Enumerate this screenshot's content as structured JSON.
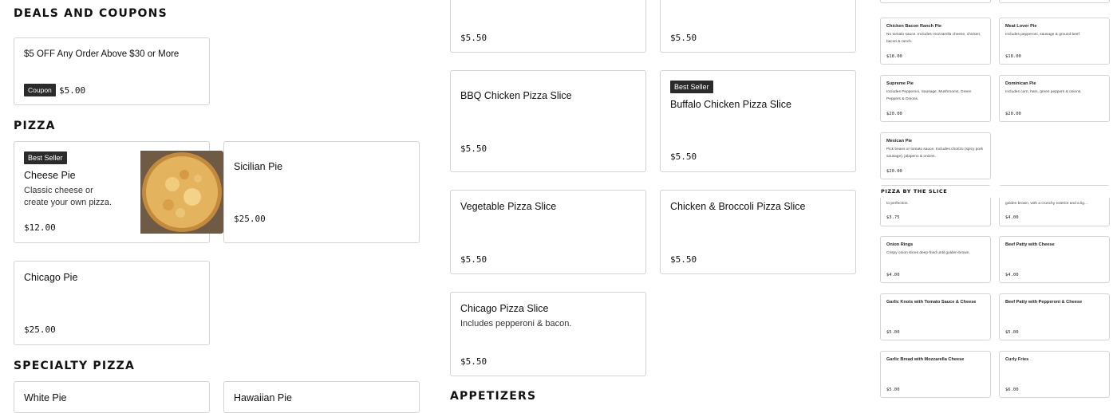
{
  "sections": {
    "deals": "DEALS AND COUPONS",
    "pizza": "PIZZA",
    "specialty": "SPECIALTY PIZZA",
    "appetizers": "APPETIZERS",
    "by_slice": "PIZZA BY THE SLICE"
  },
  "deal": {
    "title": "$5 OFF Any Order Above $30 or More",
    "badge": "Coupon",
    "amount": "$5.00"
  },
  "pizza": {
    "cheese": {
      "badge": "Best Seller",
      "name": "Cheese Pie",
      "desc": "Classic cheese or create your own pizza.",
      "price": "$12.00"
    },
    "sicilian": {
      "name": "Sicilian Pie",
      "price": "$25.00"
    },
    "chicago": {
      "name": "Chicago Pie",
      "price": "$25.00"
    }
  },
  "specialty": {
    "white": "White Pie",
    "hawaiian": "Hawaiian Pie"
  },
  "slices": {
    "top_left_price": "$5.50",
    "top_right_price": "$5.50",
    "bbq": {
      "name": "BBQ Chicken Pizza Slice",
      "price": "$5.50"
    },
    "buffalo": {
      "badge": "Best Seller",
      "name": "Buffalo Chicken Pizza Slice",
      "price": "$5.50"
    },
    "vegetable": {
      "name": "Vegetable Pizza Slice",
      "price": "$5.50"
    },
    "broccoli": {
      "name": "Chicken & Broccoli Pizza Slice",
      "price": "$5.50"
    },
    "chicago": {
      "name": "Chicago Pizza Slice",
      "desc": "Includes pepperoni & bacon.",
      "price": "$5.50"
    }
  },
  "right": {
    "chicken_bacon": {
      "name": "Chicken Bacon Ranch Pie",
      "desc": "No tomato sauce. Includes mozzarella cheese, chicken, bacon & ranch.",
      "price": "$18.00"
    },
    "meat_lover": {
      "name": "Meat Lover Pie",
      "desc": "Includes pepperoni, sausage & ground beef.",
      "price": "$18.00"
    },
    "supreme": {
      "name": "Supreme Pie",
      "desc": "Includes Pepperoni, Sausage, Mushrooms, Green Peppers & Onions.",
      "price": "$20.00"
    },
    "dominican": {
      "name": "Dominican Pie",
      "desc": "Includes corn, ham, green peppers & onions.",
      "price": "$20.00"
    },
    "mexican": {
      "name": "Mexican Pie",
      "desc": "Pick beans or tomato sauce. Includes chorizo (spicy pork sausage), jalapeno & onions.",
      "price": "$20.00"
    },
    "slice_left": {
      "desc": "to perfection.",
      "price": "$3.75"
    },
    "slice_right": {
      "desc": "golden brown, with a crunchy exterior and a lig...",
      "price": "$4.00"
    },
    "onion_rings": {
      "name": "Onion Rings",
      "desc": "Crispy onion slices deep-fried until golden-brown.",
      "price": "$4.00"
    },
    "beef_cheese": {
      "name": "Beef Patty with Cheese",
      "price": "$4.00"
    },
    "garlic_knots": {
      "name": "Garlic Knots with Tomato Sauce & Cheese",
      "price": "$5.00"
    },
    "beef_pepperoni": {
      "name": "Beef Patty with Pepperoni & Cheese",
      "price": "$5.00"
    },
    "garlic_bread": {
      "name": "Garlic Bread with Mozzarella Cheese",
      "price": "$5.00"
    },
    "curly_fries": {
      "name": "Curly Fries",
      "price": "$6.00"
    }
  }
}
